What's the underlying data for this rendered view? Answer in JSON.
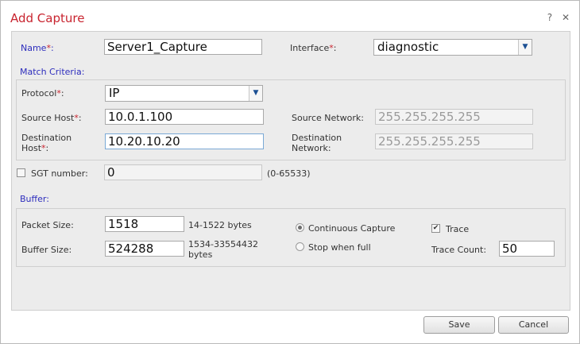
{
  "dialog": {
    "title": "Add Capture",
    "help_glyph": "?",
    "close_glyph": "✕"
  },
  "form": {
    "name_label": "Name",
    "name_value": "Server1_Capture",
    "interface_label": "Interface",
    "interface_value": "diagnostic",
    "required_mark": "*",
    "label_suffix": ":",
    "match_criteria_label": "Match Criteria:",
    "protocol_label": "Protocol",
    "protocol_value": "IP",
    "source_host_label": "Source Host",
    "source_host_value": "10.0.1.100",
    "source_network_label": "Source Network:",
    "source_network_value": "255.255.255.255",
    "destination_host_label_line1": "Destination",
    "destination_host_label_line2": "Host",
    "destination_host_value": "10.20.10.20",
    "destination_network_label_line1": "Destination",
    "destination_network_label_line2": "Network:",
    "destination_network_value": "255.255.255.255",
    "sgt_label": "SGT number:",
    "sgt_value": "0",
    "sgt_range": "(0-65533)",
    "sgt_checked": false,
    "buffer_label": "Buffer:",
    "packet_size_label": "Packet Size:",
    "packet_size_value": "1518",
    "packet_size_range": "14-1522 bytes",
    "buffer_size_label": "Buffer Size:",
    "buffer_size_value": "524288",
    "buffer_size_range_line1": "1534-33554432",
    "buffer_size_range_line2": "bytes",
    "continuous_capture_label": "Continuous Capture",
    "continuous_capture_selected": true,
    "stop_when_full_label": "Stop when full",
    "trace_label": "Trace",
    "trace_checked": true,
    "trace_count_label": "Trace Count:",
    "trace_count_value": "50"
  },
  "buttons": {
    "save": "Save",
    "cancel": "Cancel"
  },
  "colors": {
    "title": "#c8242f",
    "section": "#2d2dbd",
    "required": "#c8242f",
    "panel": "#ececec"
  }
}
